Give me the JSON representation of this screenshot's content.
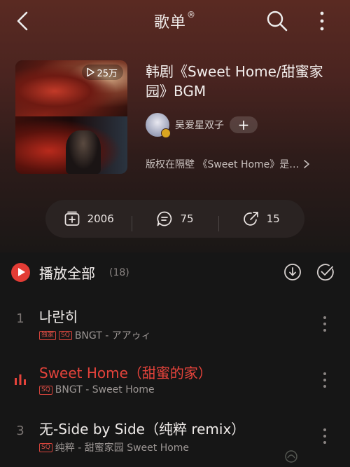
{
  "header": {
    "title": "歌单",
    "title_mark": "®"
  },
  "playlist": {
    "play_count": "25万",
    "name": "韩剧《Sweet Home/甜蜜家园》BGM",
    "author": "吴爱星双子",
    "follow_label": "+",
    "description": "版权在隔壁 《Sweet Home》是…"
  },
  "actions": {
    "collect_count": "2006",
    "comment_count": "75",
    "share_count": "15"
  },
  "list": {
    "play_all_label": "播放全部",
    "track_count": "(18)",
    "songs": [
      {
        "index": "1",
        "title": "나란히",
        "tags": [
          "独家",
          "SQ"
        ],
        "subtitle": "BNGT - アアゥィ",
        "playing": false
      },
      {
        "index": "",
        "title": "Sweet Home（甜蜜的家）",
        "tags": [
          "SQ"
        ],
        "subtitle": "BNGT - Sweet Home",
        "playing": true
      },
      {
        "index": "3",
        "title": "无-Side by Side（纯粹 remix）",
        "tags": [
          "SQ"
        ],
        "subtitle": "纯粹 - 甜蜜家园 Sweet Home",
        "playing": false
      }
    ]
  },
  "colors": {
    "accent": "#e33c35",
    "background": "#161616",
    "hero_top": "#5a2a22"
  }
}
